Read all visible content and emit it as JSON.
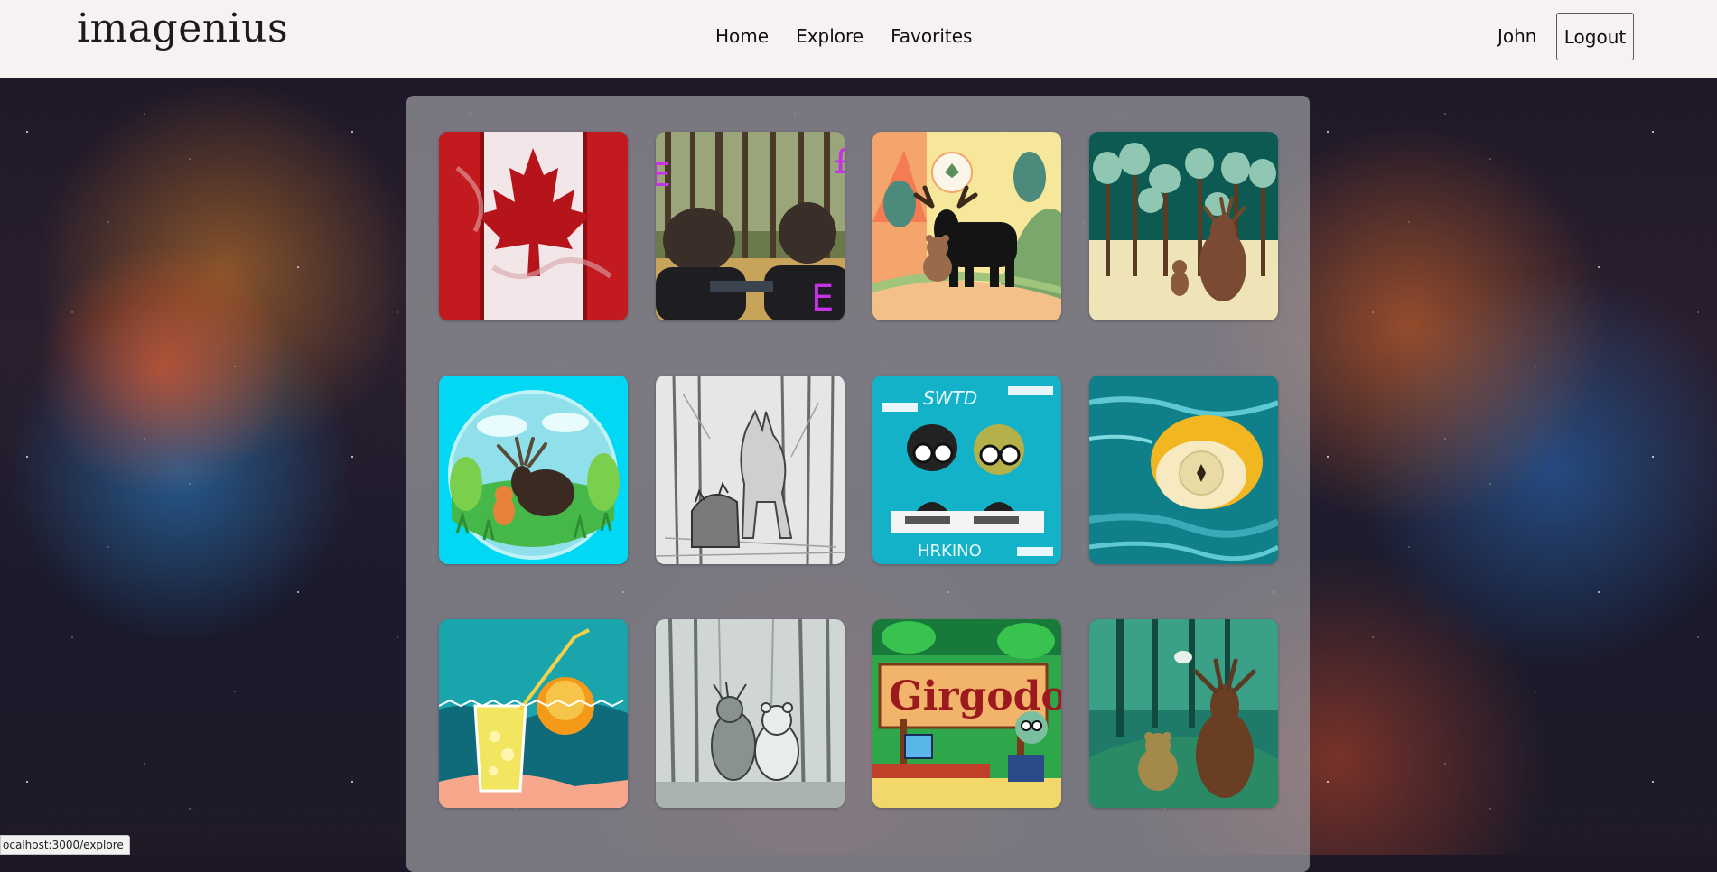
{
  "header": {
    "logo": "imagenius",
    "nav": [
      {
        "label": "Home"
      },
      {
        "label": "Explore"
      },
      {
        "label": "Favorites"
      }
    ],
    "user_name": "John",
    "logout_label": "Logout"
  },
  "gallery": {
    "tiles": [
      {
        "icon": "canada-flag-image"
      },
      {
        "icon": "people-in-forest-image"
      },
      {
        "icon": "cartoon-moose-and-bear-image"
      },
      {
        "icon": "moose-in-forest-image"
      },
      {
        "icon": "moose-in-bubble-image"
      },
      {
        "icon": "wolf-pencil-sketch-image"
      },
      {
        "icon": "cartoon-hackers-image",
        "text_top": "SWTD",
        "text_bottom": "HRKINO"
      },
      {
        "icon": "lemon-in-water-image"
      },
      {
        "icon": "lemonade-glass-image"
      },
      {
        "icon": "bears-sketch-image"
      },
      {
        "icon": "girgodo-sign-image",
        "sign_text": "Girgodo"
      },
      {
        "icon": "moose-and-bear-painting-image"
      }
    ]
  },
  "status_bar": {
    "url": "ocalhost:3000/explore"
  }
}
